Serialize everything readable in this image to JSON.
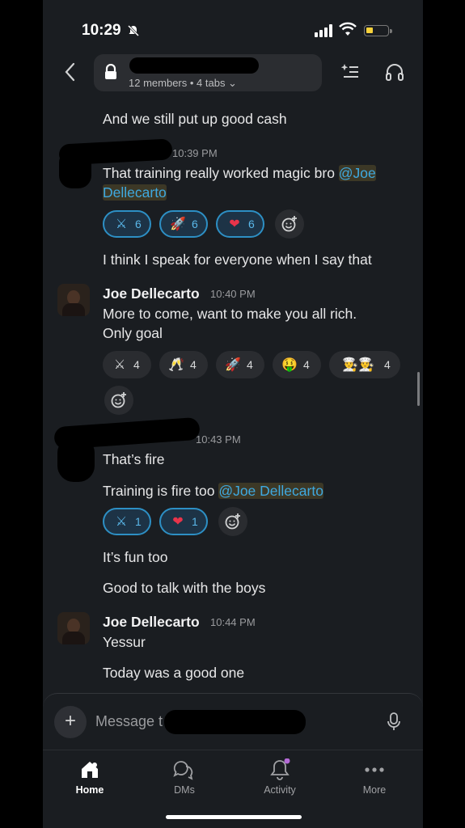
{
  "status_bar": {
    "time": "10:29"
  },
  "header": {
    "channel_meta": "12 members • 4 tabs ⌄"
  },
  "messages": {
    "m0": {
      "text": "And we still put up good cash"
    },
    "m1": {
      "timestamp": "10:39 PM",
      "text": "That training really worked magic bro ",
      "mention_line1": "@Joe",
      "mention_line2": "Dellecarto",
      "followup": "I think I speak for everyone when I say that"
    },
    "m2": {
      "author": "Joe Dellecarto",
      "timestamp": "10:40 PM",
      "line1": "More to come, want to make you all rich.",
      "line2": "Only goal"
    },
    "m3": {
      "timestamp": "10:43 PM",
      "text1": "That’s fire",
      "text2": "Training is fire too ",
      "mention": "@Joe Dellecarto",
      "text3": "It’s fun too",
      "text4": "Good to talk with the boys"
    },
    "m4": {
      "author": "Joe Dellecarto",
      "timestamp": "10:44 PM",
      "line1": "Yessur",
      "line2": "Today was a good one"
    }
  },
  "reactions": {
    "m1": [
      {
        "emoji": "⚔",
        "count": "6"
      },
      {
        "emoji": "🚀",
        "count": "6"
      },
      {
        "emoji": "❤",
        "count": "6"
      }
    ],
    "m2": [
      {
        "emoji": "⚔",
        "count": "4"
      },
      {
        "emoji": "🥂",
        "count": "4"
      },
      {
        "emoji": "🚀",
        "count": "4"
      },
      {
        "emoji": "🤑",
        "count": "4"
      },
      {
        "emoji": "👨‍🍳👨‍🍳",
        "count": "4"
      }
    ],
    "m3": [
      {
        "emoji": "⚔",
        "count": "1"
      },
      {
        "emoji": "❤",
        "count": "1"
      }
    ]
  },
  "composer": {
    "placeholder": "Message t"
  },
  "tabs": [
    {
      "label": "Home",
      "icon": "home-icon"
    },
    {
      "label": "DMs",
      "icon": "dms-icon"
    },
    {
      "label": "Activity",
      "icon": "bell-icon"
    },
    {
      "label": "More",
      "icon": "more-icon"
    }
  ],
  "colors": {
    "mention": "#3fa9e0",
    "mine_reaction_border": "#2d8fc4",
    "activity_dot": "#b46ad6"
  }
}
